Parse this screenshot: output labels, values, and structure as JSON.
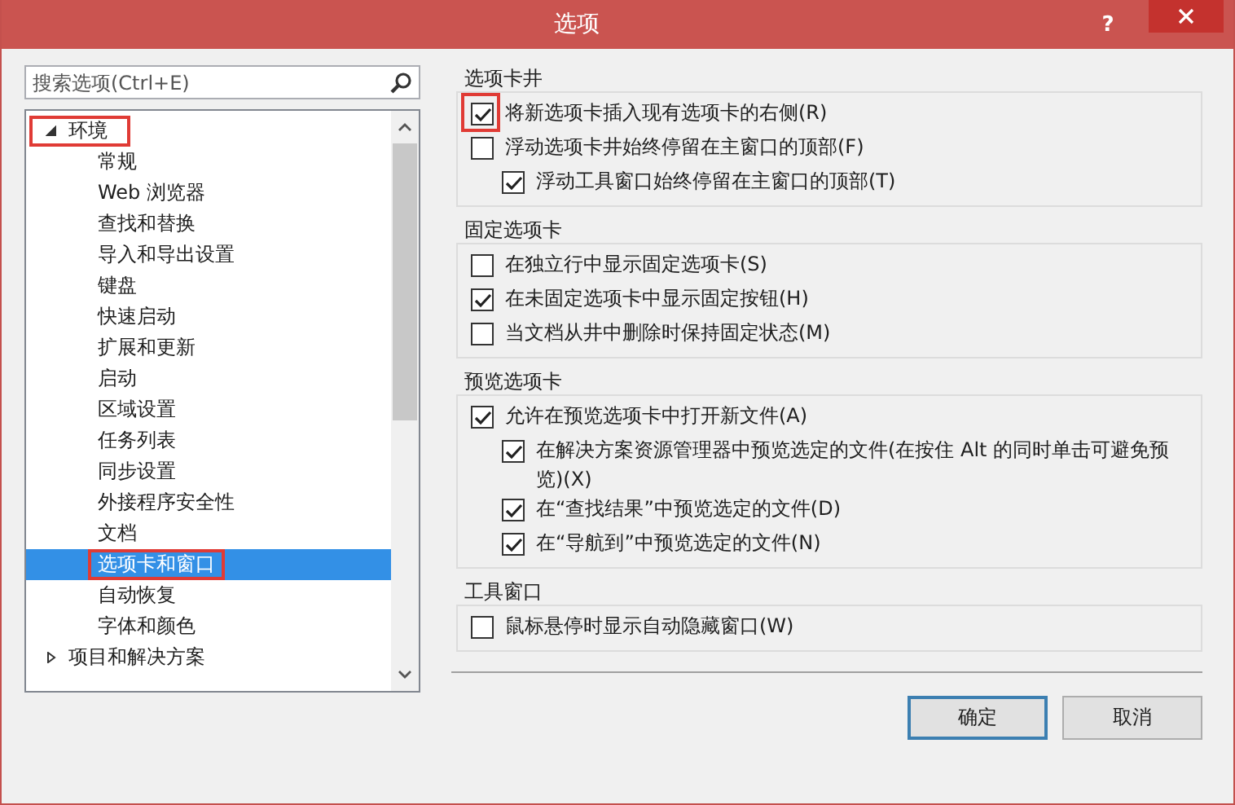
{
  "window": {
    "title": "选项",
    "help": "?"
  },
  "search": {
    "placeholder": "搜索选项(Ctrl+E)"
  },
  "tree": [
    {
      "label": "环境",
      "expanded": true,
      "selected": false,
      "highlighted": true,
      "children": [
        {
          "label": "常规",
          "selected": false,
          "highlighted": false
        },
        {
          "label": "Web 浏览器",
          "selected": false,
          "highlighted": false
        },
        {
          "label": "查找和替换",
          "selected": false,
          "highlighted": false
        },
        {
          "label": "导入和导出设置",
          "selected": false,
          "highlighted": false
        },
        {
          "label": "键盘",
          "selected": false,
          "highlighted": false
        },
        {
          "label": "快速启动",
          "selected": false,
          "highlighted": false
        },
        {
          "label": "扩展和更新",
          "selected": false,
          "highlighted": false
        },
        {
          "label": "启动",
          "selected": false,
          "highlighted": false
        },
        {
          "label": "区域设置",
          "selected": false,
          "highlighted": false
        },
        {
          "label": "任务列表",
          "selected": false,
          "highlighted": false
        },
        {
          "label": "同步设置",
          "selected": false,
          "highlighted": false
        },
        {
          "label": "外接程序安全性",
          "selected": false,
          "highlighted": false
        },
        {
          "label": "文档",
          "selected": false,
          "highlighted": false
        },
        {
          "label": "选项卡和窗口",
          "selected": true,
          "highlighted": true
        },
        {
          "label": "自动恢复",
          "selected": false,
          "highlighted": false
        },
        {
          "label": "字体和颜色",
          "selected": false,
          "highlighted": false
        }
      ]
    },
    {
      "label": "项目和解决方案",
      "expanded": false,
      "selected": false,
      "highlighted": false
    }
  ],
  "groups": [
    {
      "title": "选项卡井",
      "options": [
        {
          "label": "将新选项卡插入现有选项卡的右侧(R)",
          "checked": true,
          "highlighted": true
        },
        {
          "label": "浮动选项卡井始终停留在主窗口的顶部(F)",
          "checked": false,
          "highlighted": false,
          "children": [
            {
              "label": "浮动工具窗口始终停留在主窗口的顶部(T)",
              "checked": true,
              "highlighted": false
            }
          ]
        }
      ]
    },
    {
      "title": "固定选项卡",
      "options": [
        {
          "label": "在独立行中显示固定选项卡(S)",
          "checked": false,
          "highlighted": false
        },
        {
          "label": "在未固定选项卡中显示固定按钮(H)",
          "checked": true,
          "highlighted": false
        },
        {
          "label": "当文档从井中删除时保持固定状态(M)",
          "checked": false,
          "highlighted": false
        }
      ]
    },
    {
      "title": "预览选项卡",
      "options": [
        {
          "label": "允许在预览选项卡中打开新文件(A)",
          "checked": true,
          "highlighted": false,
          "children": [
            {
              "label": "在解决方案资源管理器中预览选定的文件(在按住 Alt 的同时单击可避免预览)(X)",
              "checked": true,
              "highlighted": false
            },
            {
              "label": "在“查找结果”中预览选定的文件(D)",
              "checked": true,
              "highlighted": false
            },
            {
              "label": "在“导航到”中预览选定的文件(N)",
              "checked": true,
              "highlighted": false
            }
          ]
        }
      ]
    },
    {
      "title": "工具窗口",
      "options": [
        {
          "label": "鼠标悬停时显示自动隐藏窗口(W)",
          "checked": false,
          "highlighted": false
        }
      ]
    }
  ],
  "buttons": [
    {
      "label": "确定",
      "default": true
    },
    {
      "label": "取消",
      "default": false
    }
  ]
}
